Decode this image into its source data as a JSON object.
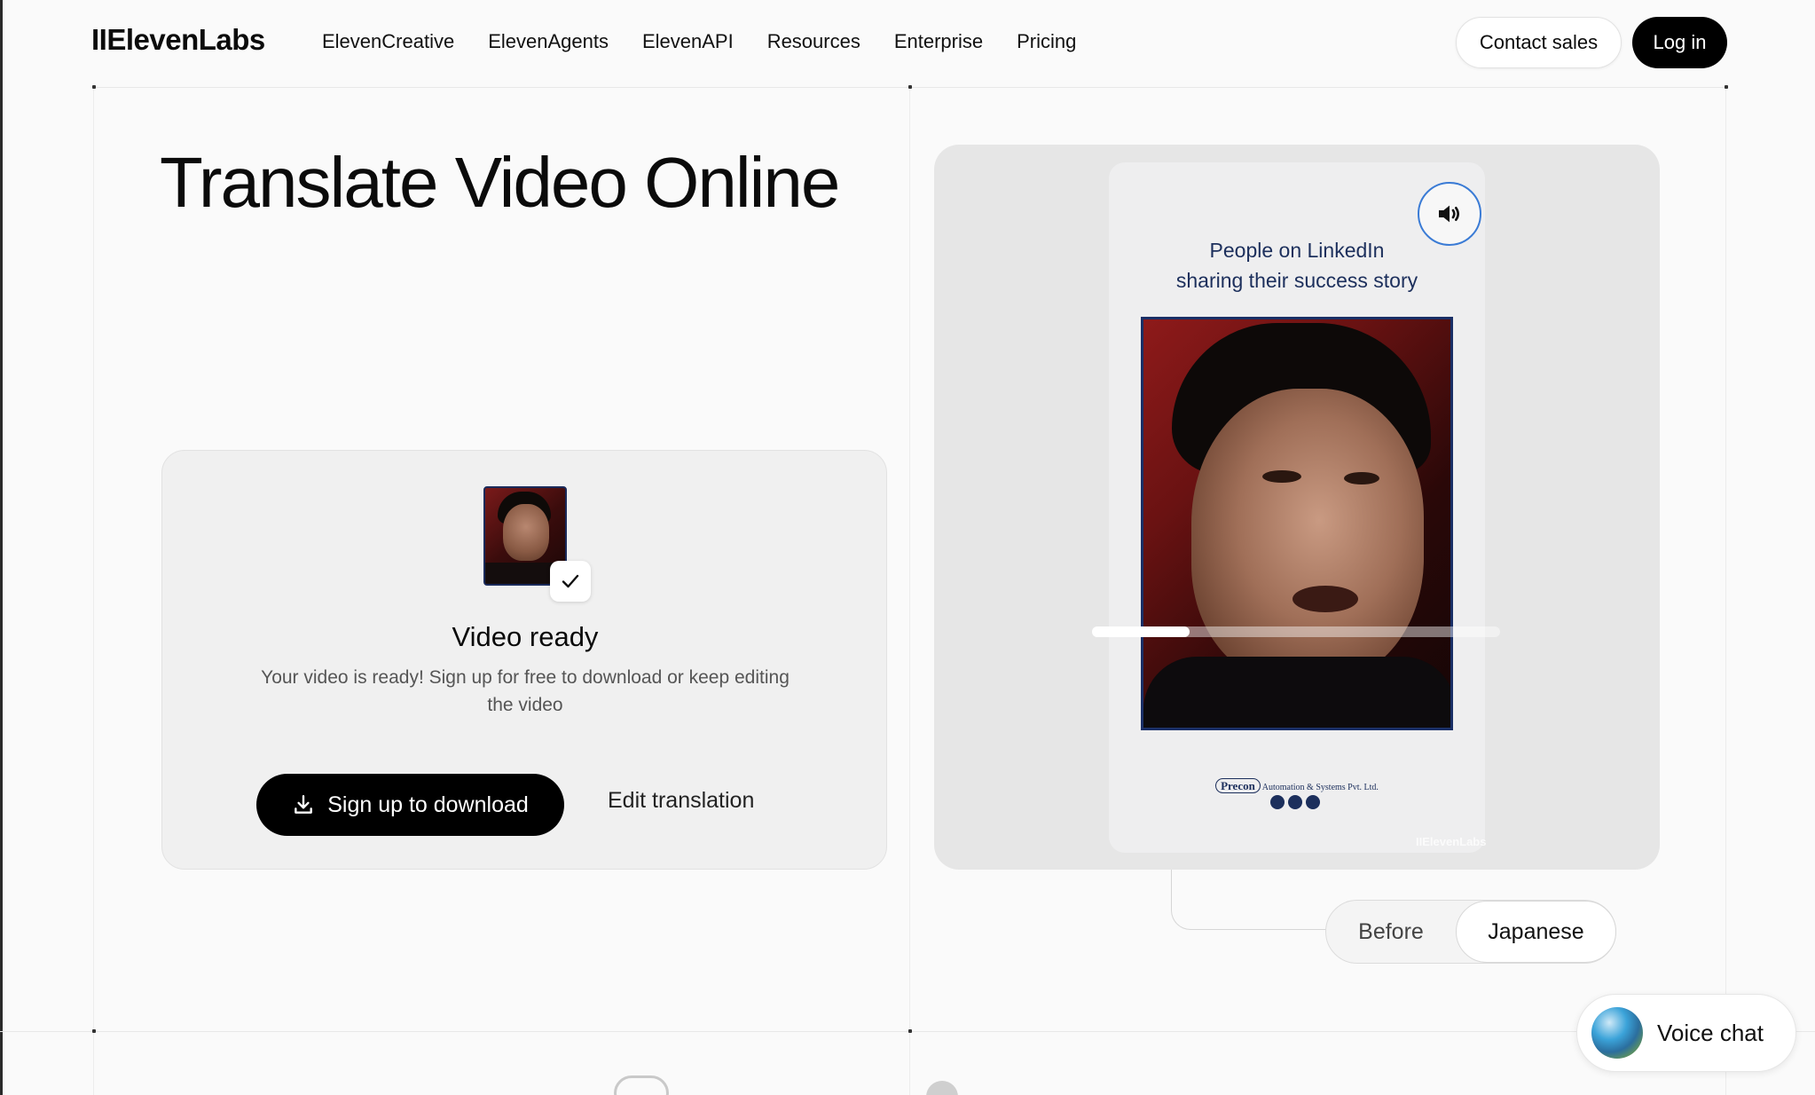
{
  "nav": {
    "logo": "IIElevenLabs",
    "links": [
      "ElevenCreative",
      "ElevenAgents",
      "ElevenAPI",
      "Resources",
      "Enterprise",
      "Pricing"
    ],
    "contact_label": "Contact sales",
    "login_label": "Log in"
  },
  "hero": {
    "title": "Translate Video Online"
  },
  "card": {
    "title": "Video ready",
    "description": "Your video is ready! Sign up for free to download or keep editing the video",
    "signup_label": "Sign up to download",
    "edit_label": "Edit translation"
  },
  "preview": {
    "caption_line1": "People on LinkedIn",
    "caption_line2": "sharing their success story",
    "company_logo": "Precon",
    "company_name": "Automation & Systems Pvt. Ltd.",
    "watermark": "IIElevenLabs",
    "progress": 0.24
  },
  "toggle": {
    "before_label": "Before",
    "language_label": "Japanese"
  },
  "voice_chat": {
    "label": "Voice chat"
  },
  "colors": {
    "accent_blue": "#3a7bd5",
    "caption_navy": "#1c2f5c",
    "button_black": "#000000"
  }
}
